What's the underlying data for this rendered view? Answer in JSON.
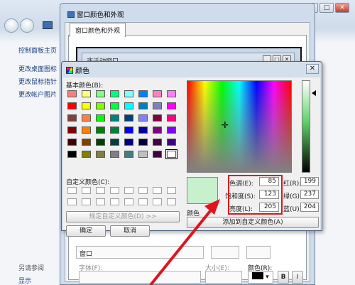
{
  "control_panel": {
    "title_buttons": [
      "–",
      "□",
      "✕"
    ],
    "sidebar_links": [
      "控制面板主页",
      "更改桌面图标",
      "更改鼠标指针",
      "更改帐户图片"
    ],
    "see_also": "另请参阅",
    "display": "显示"
  },
  "window_color_dialog": {
    "title": "窗口颜色和外观",
    "tab": "窗口颜色和外观",
    "inactive_window_label": "非活动窗口",
    "font_label": "字体(F):",
    "size_label": "大小(E):",
    "color_label": "颜色(R):",
    "bold_button": "B",
    "italic_button": "I",
    "item_field_partial": "窗口"
  },
  "color_dialog": {
    "title": "颜色",
    "close": "✕",
    "basic_colors_label": "基本颜色(B):",
    "custom_colors_label": "自定义颜色(C):",
    "define_custom_button": "规定自定义颜色(D) >>",
    "ok_button": "确定",
    "cancel_button": "取消",
    "color_solid_label": "颜色",
    "add_custom_button": "添加到自定义颜色(A)",
    "current_color": "#c7f0cd",
    "basic_colors": [
      [
        "#f08080",
        "#ffff80",
        "#80ff80",
        "#00ff80",
        "#80ffff",
        "#0080ff",
        "#ff80c0",
        "#ff80ff"
      ],
      [
        "#ff0000",
        "#ffff00",
        "#80ff00",
        "#00ff40",
        "#00ffff",
        "#0080c0",
        "#8080c0",
        "#ff00ff"
      ],
      [
        "#804040",
        "#ff8040",
        "#00ff00",
        "#008080",
        "#004080",
        "#8080ff",
        "#800040",
        "#ff0080"
      ],
      [
        "#800000",
        "#ff8000",
        "#008000",
        "#008040",
        "#0000ff",
        "#0000a0",
        "#800080",
        "#8000ff"
      ],
      [
        "#400000",
        "#804000",
        "#004000",
        "#004040",
        "#000080",
        "#000040",
        "#400040",
        "#400080"
      ],
      [
        "#000000",
        "#808000",
        "#808040",
        "#808080",
        "#408080",
        "#c0c0c0",
        "#400040",
        "#ffffff"
      ]
    ],
    "fields": {
      "hue": {
        "label": "色调(E):",
        "value": "85"
      },
      "sat": {
        "label": "饱和度(S):",
        "value": "123"
      },
      "lum": {
        "label": "亮度(L):",
        "value": "205"
      },
      "red": {
        "label": "红(R):",
        "value": "199"
      },
      "green": {
        "label": "绿(G):",
        "value": "237"
      },
      "blue": {
        "label": "蓝(U):",
        "value": "204"
      }
    }
  },
  "colors": {
    "highlight_box": "#e0141e",
    "arrow": "#e0141e"
  }
}
